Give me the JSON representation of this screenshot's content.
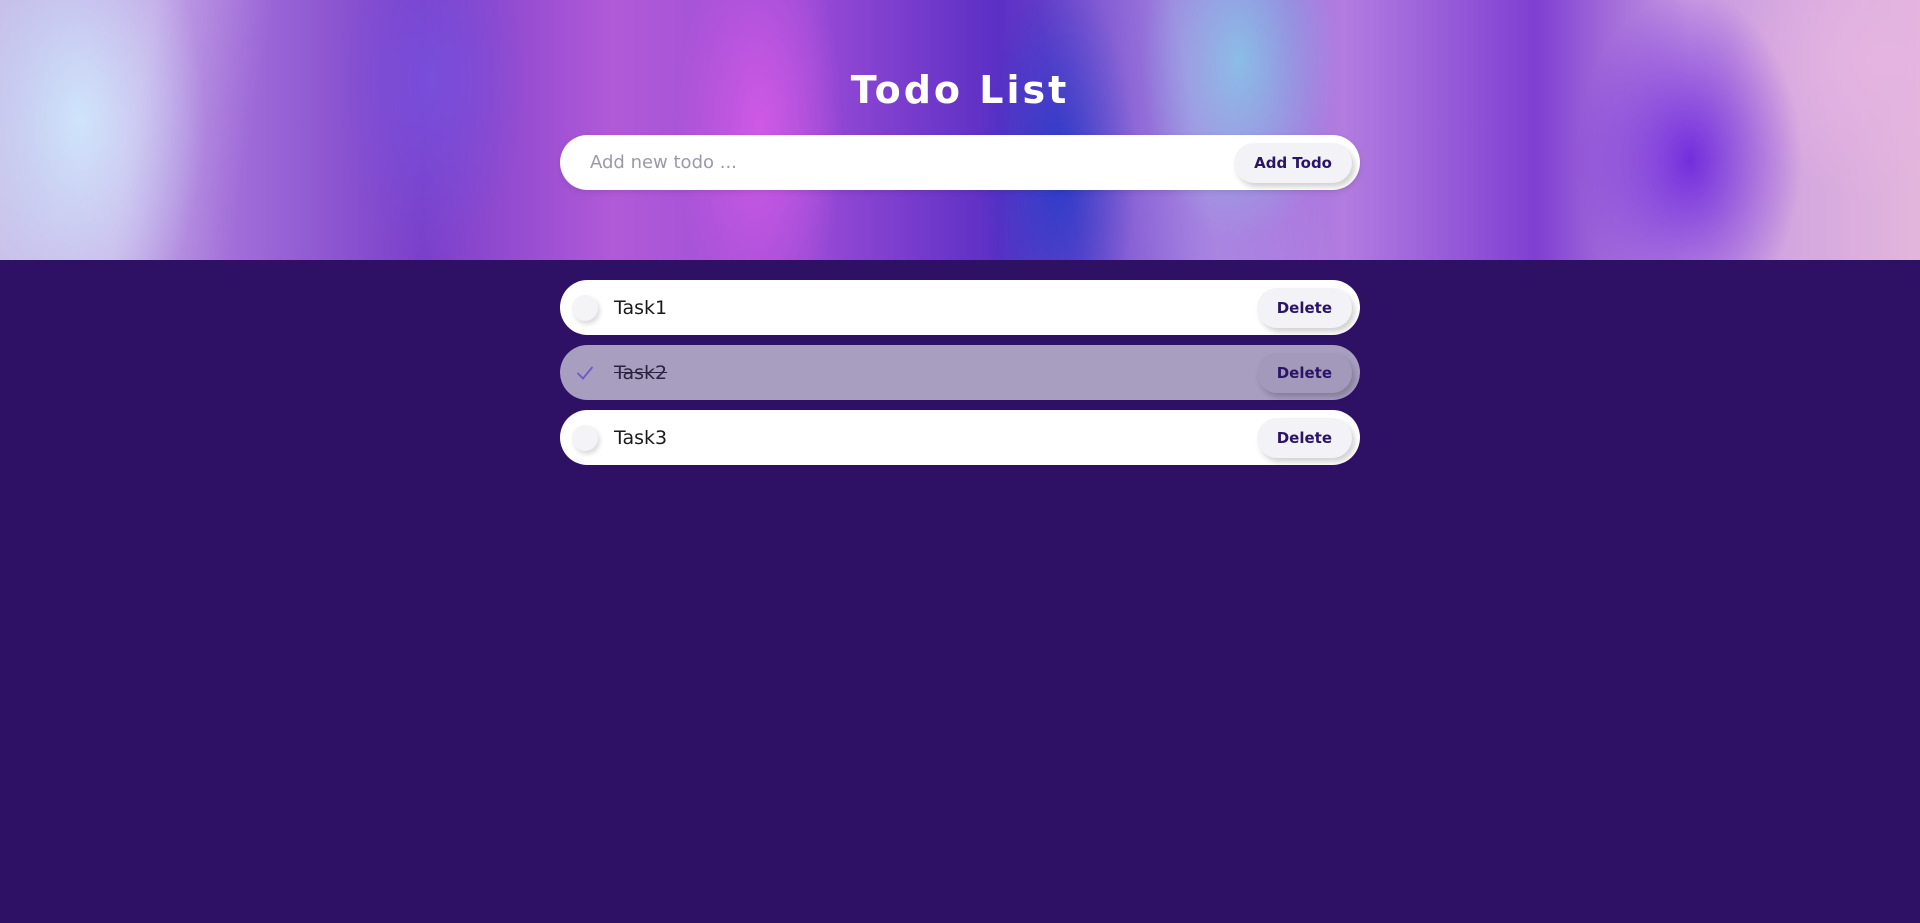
{
  "app": {
    "title": "Todo List"
  },
  "add_form": {
    "placeholder": "Add new todo ...",
    "value": "",
    "button_label": "Add Todo"
  },
  "todos": [
    {
      "text": "Task1",
      "completed": false,
      "delete_label": "Delete"
    },
    {
      "text": "Task2",
      "completed": true,
      "delete_label": "Delete"
    },
    {
      "text": "Task3",
      "completed": false,
      "delete_label": "Delete"
    }
  ],
  "colors": {
    "background": "#2e1165",
    "accent_text": "#2b1466",
    "completed_item": "#a79ec0",
    "check_mark": "#6a5acd"
  }
}
